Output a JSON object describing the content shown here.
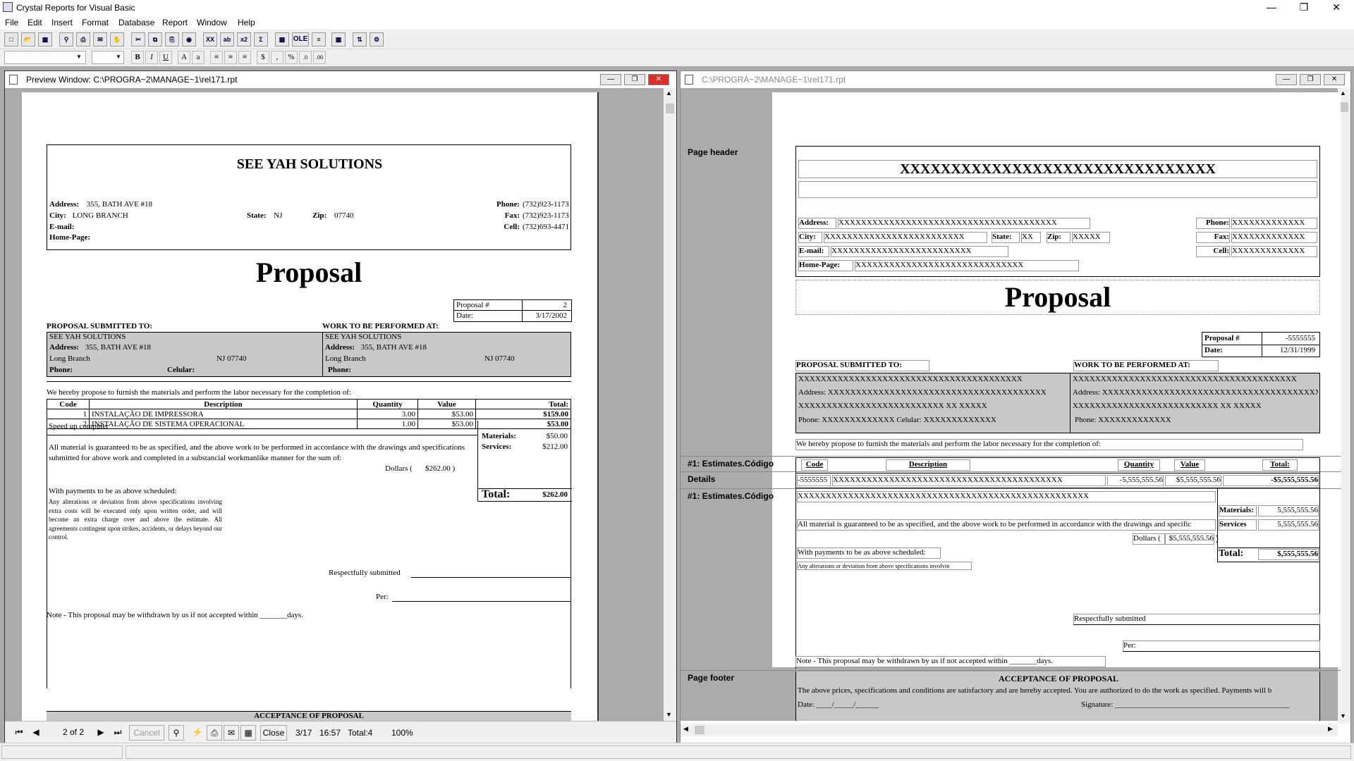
{
  "app": {
    "title": "Crystal Reports for Visual Basic"
  },
  "menu": [
    "File",
    "Edit",
    "Insert",
    "Format",
    "Database",
    "Report",
    "Window",
    "Help"
  ],
  "toolbar": {
    "ole_label": "OLE",
    "font_name": "",
    "font_size": ""
  },
  "preview": {
    "title": "Preview Window: C:\\PROGRA~2\\MANAGE~1\\rel171.rpt",
    "company": "SEE YAH SOLUTIONS",
    "address_label": "Address:",
    "address": "355, BATH AVE #18",
    "city_label": "City:",
    "city": "LONG BRANCH",
    "state_label": "State:",
    "state": "NJ",
    "zip_label": "Zip:",
    "zip": "07740",
    "email_label": "E-mail:",
    "home_label": "Home-Page:",
    "phone_label": "Phone:",
    "phone": "(732)923-1173",
    "fax_label": "Fax:",
    "fax": "(732)923-1173",
    "cell_label": "Cell:",
    "cell": "(732)693-4471",
    "heading": "Proposal",
    "proposal_no_label": "Proposal #",
    "proposal_no": "2",
    "date_label": "Date:",
    "date": "3/17/2002",
    "submitted_to_label": "PROPOSAL SUBMITTED TO:",
    "work_at_label": "WORK TO BE PERFORMED AT:",
    "client_name": "SEE YAH SOLUTIONS",
    "client_city": "Long Branch",
    "client_state_zip": "NJ      07740",
    "celular_label": "Celular:",
    "intro": "We hereby propose to furnish the materials and perform the labor necessary for the completion of:",
    "columns": [
      "Code",
      "Description",
      "Quantity",
      "Value",
      "Total:"
    ],
    "items": [
      {
        "code": "1",
        "description": "INSTALAÇÃO DE IMPRESSORA",
        "qty": "3.00",
        "value": "$53.00",
        "total": "$159.00"
      },
      {
        "code": "2",
        "description": "INSTALAÇÃO DE SISTEMA OPERACIONAL",
        "qty": "1.00",
        "value": "$53.00",
        "total": "$53.00"
      }
    ],
    "note_item": "Speed  up computer",
    "guarantee": "All material is guaranteed to be as specified, and the above work to be performed in accordance with the drawings and specifications submitted for above work and completed in a substancial workmanlike manner for the sum of:",
    "dollars_label": "Dollars (",
    "dollars": "$262.00 )",
    "materials_label": "Materials:",
    "materials": "$50.00",
    "services_label": "Services:",
    "services": "$212.00",
    "total_label": "Total:",
    "total": "$262.00",
    "payments": "With payments to be as above scheduled:",
    "fine_print": "Any alterations or deviation from above specifications involving extra costs will be executed only upon written order, and will become an extra charge over and above the estimate. All agreements contingent upon strikes, accidents, or delays beyond our control.",
    "respectfully": "Respectfully submitted",
    "per": "Per:",
    "note": "Note - This proposal may be withdrawn by us if not accepted within _______days.",
    "acceptance": "ACCEPTANCE OF PROPOSAL",
    "nav": {
      "page": "2 of 2",
      "cancel": "Cancel",
      "close": "Close",
      "date": "3/17",
      "time": "16:57",
      "total": "Total:4",
      "zoom": "100%"
    }
  },
  "design": {
    "title": "C:\\PROGRA~2\\MANAGE~1\\rel171.rpt",
    "sections": [
      "Page header",
      "#1: Estimates.Código",
      "Details",
      "#1: Estimates.Código",
      "Page footer"
    ],
    "x_company": "XXXXXXXXXXXXXXXXXXXXXXXXXXXXXXX",
    "address_label": "Address:",
    "x_address": "XXXXXXXXXXXXXXXXXXXXXXXXXXXXXXXXXXXXXXX",
    "city_label": "City:",
    "x_city": "XXXXXXXXXXXXXXXXXXXXXXXXX",
    "state_label": "State:",
    "x_state": "XX",
    "zip_label": "Zip:",
    "x_zip": "XXXXX",
    "email_label": "E-mail:",
    "x_email": "XXXXXXXXXXXXXXXXXXXXXXXXX",
    "home_label": "Home-Page:",
    "x_home": "XXXXXXXXXXXXXXXXXXXXXXXXXXXXXX",
    "phone_label": "Phone:",
    "fax_label": "Fax:",
    "cell_label": "Cell:",
    "x_phone": "XXXXXXXXXXXXX",
    "heading": "Proposal",
    "proposal_no_label": "Proposal #",
    "x_proposal_no": "-5555555",
    "date_label": "Date:",
    "x_date": "12/31/1999",
    "submitted_to_label": "PROPOSAL SUBMITTED TO:",
    "work_at_label": "WORK TO BE PERFORMED AT:",
    "x_long": "XXXXXXXXXXXXXXXXXXXXXXXXXXXXXXXXXXXXXXXX",
    "x_addr2": "Address: XXXXXXXXXXXXXXXXXXXXXXXXXXXXXXXXXXXXXXX",
    "x_city2": "XXXXXXXXXXXXXXXXXXXXXXXXXX  XX  XXXXX",
    "x_phone2": "Phone: XXXXXXXXXXXXX   Celular:  XXXXXXXXXXXXX",
    "x_phone3": "Phone:  XXXXXXXXXXXXX",
    "intro": "We hereby propose to furnish the materials and perform the labor necessary for the completion of:",
    "columns": [
      "Code",
      "Description",
      "Quantity",
      "Value",
      "Total:"
    ],
    "x_row": [
      "-5555555",
      "XXXXXXXXXXXXXXXXXXXXXXXXXXXXXXXXXXXXXXXXX",
      "-5,555,555.56",
      "$5,555,555.56",
      "-$5,555,555.56"
    ],
    "x_desc": "XXXXXXXXXXXXXXXXXXXXXXXXXXXXXXXXXXXXXXXXXXXXXXXXXXXX",
    "guarantee": "All material is guaranteed to be as specified, and the above work to be performed in accordance with the drawings and specific",
    "materials_label": "Materials:",
    "services_label": "Services",
    "x_money": "5,555,555.56",
    "dollars_label": "Dollars (",
    "x_dollars": "$5,555,555.56",
    "paren": ")",
    "total_label": "Total:",
    "x_total": "$,555,555.56",
    "payments": "With payments to be as above scheduled:",
    "fine_print": "Any alterations or deviation from above specifications involvin",
    "respectfully": "Respectfully submitted",
    "per": "Per:",
    "note": "Note - This proposal may be withdrawn by us if not accepted within _______days.",
    "acceptance": "ACCEPTANCE OF PROPOSAL",
    "accept_text": "The above prices, specifications and conditions are satisfactory and are hereby accepted. You are authorized to do the work as specified. Payments will b",
    "accept_date": "Date: ____/_____/______",
    "accept_sig": "Signature: _____________________________________________"
  }
}
